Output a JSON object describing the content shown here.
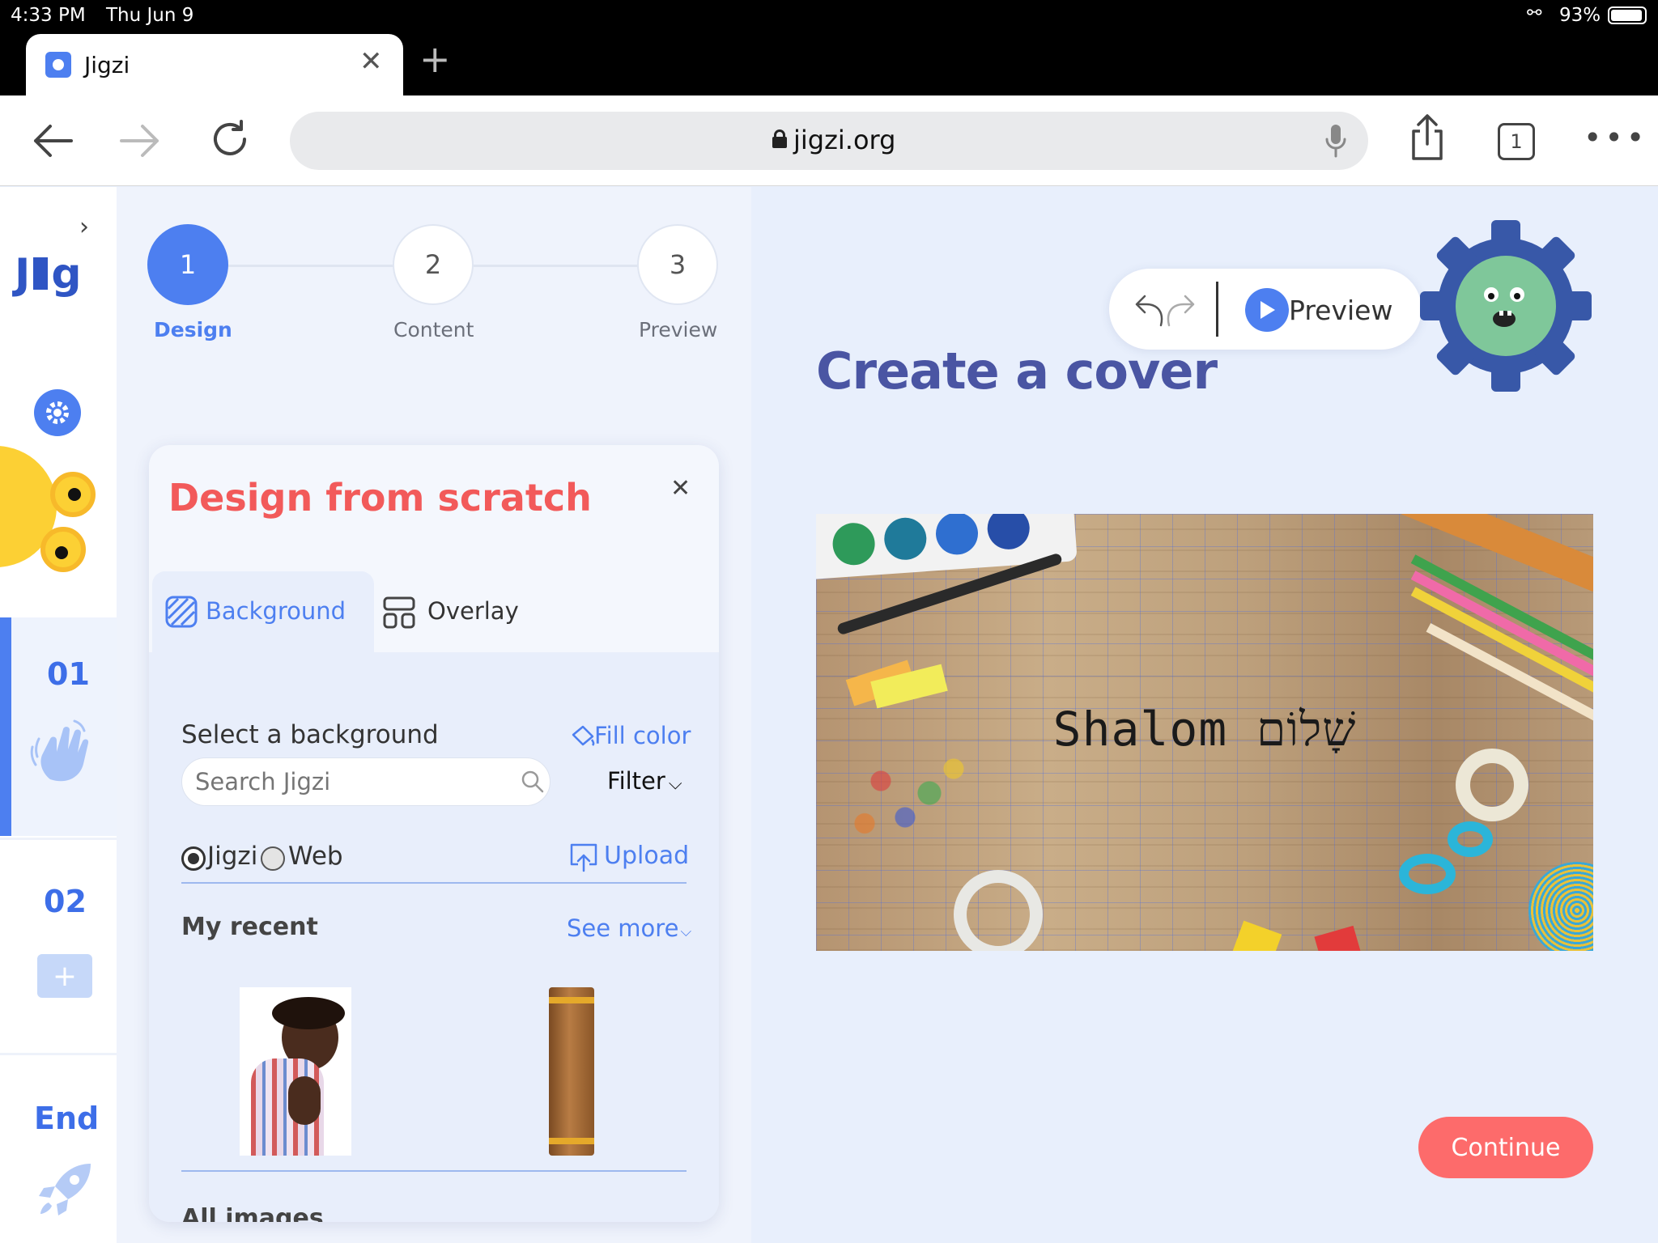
{
  "status": {
    "time": "4:33 PM",
    "date": "Thu Jun 9",
    "battery": "93%"
  },
  "browser": {
    "tab_title": "Jigzi",
    "url": "jigzi.org",
    "tab_count": "1"
  },
  "rail": {
    "logo": "J",
    "logo_tail": "g",
    "slides": [
      {
        "label": "01"
      },
      {
        "label": "02"
      },
      {
        "label": "End"
      }
    ],
    "add_label": "+"
  },
  "steps": [
    {
      "num": "1",
      "label": "Design"
    },
    {
      "num": "2",
      "label": "Content"
    },
    {
      "num": "3",
      "label": "Preview"
    }
  ],
  "panel": {
    "title": "Design from scratch",
    "tabs": [
      {
        "label": "Background"
      },
      {
        "label": "Overlay"
      }
    ],
    "select_label": "Select a background",
    "fill_color": "Fill color",
    "search_placeholder": "Search Jigzi",
    "filter": "Filter",
    "source_jigzi": "Jigzi",
    "source_web": "Web",
    "upload": "Upload",
    "my_recent": "My recent",
    "see_more": "See more",
    "all_images": "All images"
  },
  "stage": {
    "preview_label": "Preview",
    "heading": "Create a cover",
    "canvas_text": "Shalom שָׁלוֹם",
    "continue_label": "Continue"
  },
  "colors": {
    "accent_blue": "#4d7ff0",
    "heading_navy": "#4a55a3",
    "title_red": "#f25a5a",
    "continue_red": "#fd6b6b"
  }
}
